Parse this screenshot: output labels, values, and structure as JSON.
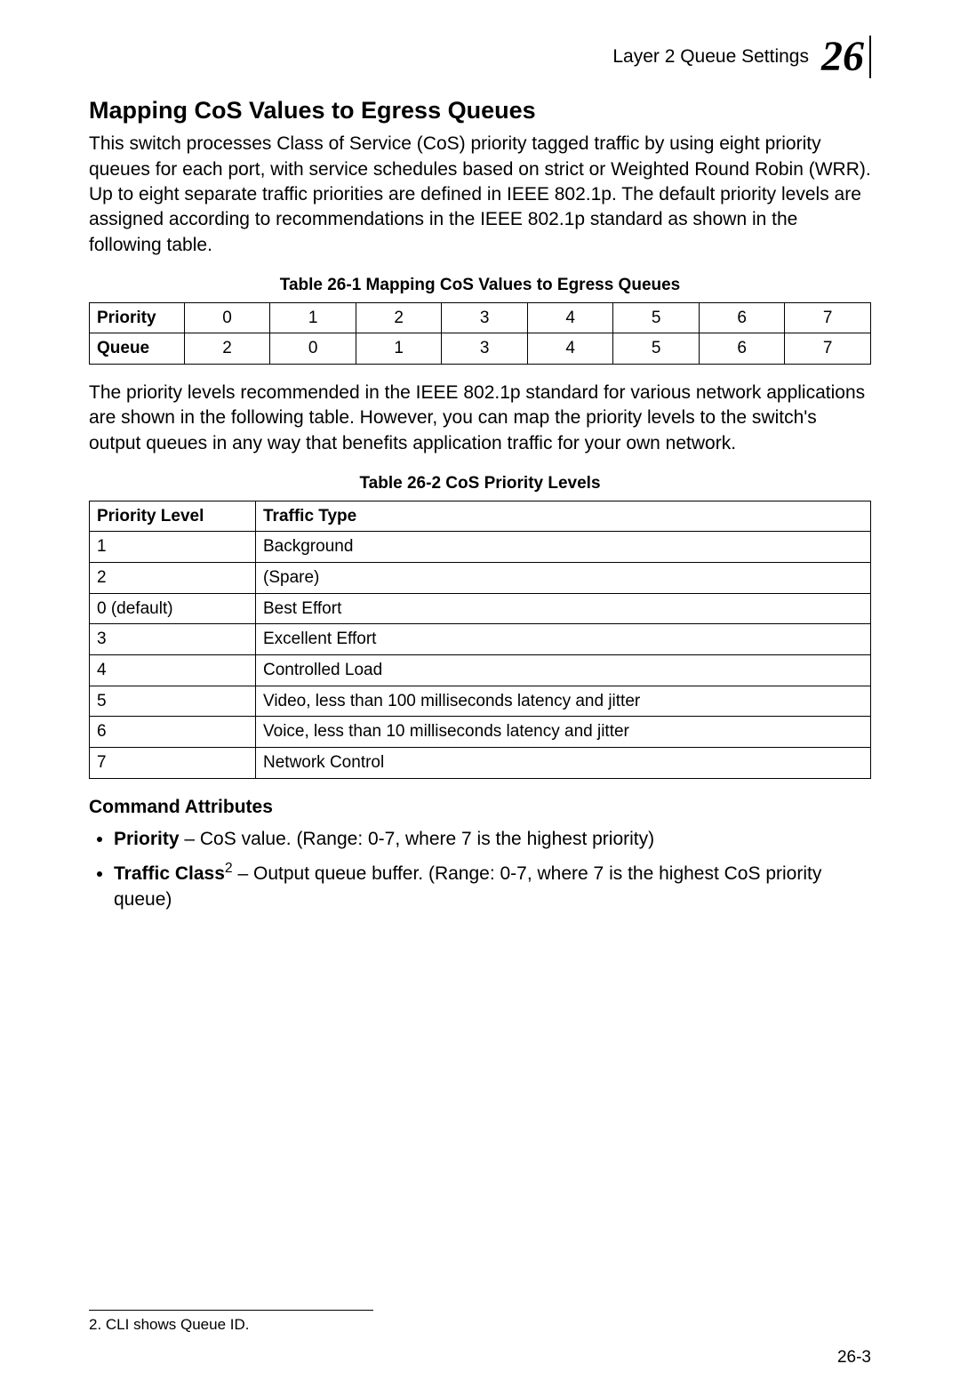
{
  "header": {
    "section": "Layer 2 Queue Settings",
    "chapter": "26"
  },
  "title": "Mapping CoS Values to Egress Queues",
  "intro": "This switch processes Class of Service (CoS) priority tagged traffic by using eight priority queues for each port, with service schedules based on strict or Weighted Round Robin (WRR). Up to eight separate traffic priorities are defined in IEEE 802.1p. The default priority levels are assigned according to recommendations in the IEEE 802.1p standard as shown in the following table.",
  "table1": {
    "caption": "Table 26-1   Mapping CoS Values to Egress Queues",
    "row_priority_label": "Priority",
    "row_queue_label": "Queue",
    "priority": [
      "0",
      "1",
      "2",
      "3",
      "4",
      "5",
      "6",
      "7"
    ],
    "queue": [
      "2",
      "0",
      "1",
      "3",
      "4",
      "5",
      "6",
      "7"
    ]
  },
  "mid_para": "The priority levels recommended in the IEEE 802.1p standard for various network applications are shown in the following table. However, you can map the priority levels to the switch's output queues in any way that benefits application traffic for your own network.",
  "table2": {
    "caption": "Table 26-2   CoS Priority Levels",
    "col_priority": "Priority Level",
    "col_traffic": "Traffic Type",
    "rows": [
      {
        "level": "1",
        "type": "Background"
      },
      {
        "level": "2",
        "type": "(Spare)"
      },
      {
        "level": "0 (default)",
        "type": "Best Effort"
      },
      {
        "level": "3",
        "type": "Excellent Effort"
      },
      {
        "level": "4",
        "type": "Controlled Load"
      },
      {
        "level": "5",
        "type": "Video, less than 100 milliseconds latency and jitter"
      },
      {
        "level": "6",
        "type": "Voice, less than 10 milliseconds latency and jitter"
      },
      {
        "level": "7",
        "type": "Network Control"
      }
    ]
  },
  "cmd_attr_heading": "Command Attributes",
  "attrs": {
    "priority_label": "Priority",
    "priority_desc": " – CoS value. (Range: 0-7, where 7 is the highest priority)",
    "traffic_label": "Traffic Class",
    "traffic_sup": "2",
    "traffic_desc": " – Output queue buffer. (Range: 0-7, where 7 is the highest CoS priority queue)"
  },
  "footnote": "2.  CLI shows Queue ID.",
  "page_number": "26-3"
}
